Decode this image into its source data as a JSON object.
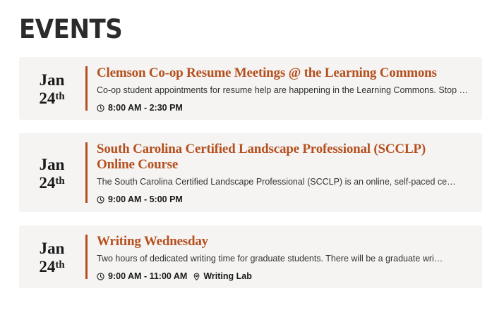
{
  "heading": "EVENTS",
  "events": [
    {
      "month": "Jan",
      "day": "24",
      "suffix": "th",
      "title": "Clemson Co-op Resume Meetings @ the Learning Commons",
      "description": "Co-op student appointments for resume help are happening in the Learning Commons. Stop …",
      "time": "8:00 AM - 2:30 PM",
      "location": "",
      "time_icon": "clock-icon"
    },
    {
      "month": "Jan",
      "day": "24",
      "suffix": "th",
      "title_line1": "South Carolina Certified Landscape Professional (SCCLP)",
      "title_line2": "Online Course",
      "description": "The South Carolina Certified Landscape Professional (SCCLP) is an online, self-paced ce…",
      "time": "9:00 AM - 5:00 PM",
      "location": "",
      "time_icon": "clock-icon"
    },
    {
      "month": "Jan",
      "day": "24",
      "suffix": "th",
      "title": "Writing Wednesday",
      "description": "Two hours of dedicated writing time for graduate students. There will be a graduate wri…",
      "time": "9:00 AM - 11:00 AM",
      "location": "Writing Lab",
      "time_icon": "clock-icon",
      "location_icon": "map-pin-icon"
    }
  ],
  "colors": {
    "accent": "#b5501e",
    "card_background": "#f5f4f3",
    "heading": "#2b2b2b"
  }
}
